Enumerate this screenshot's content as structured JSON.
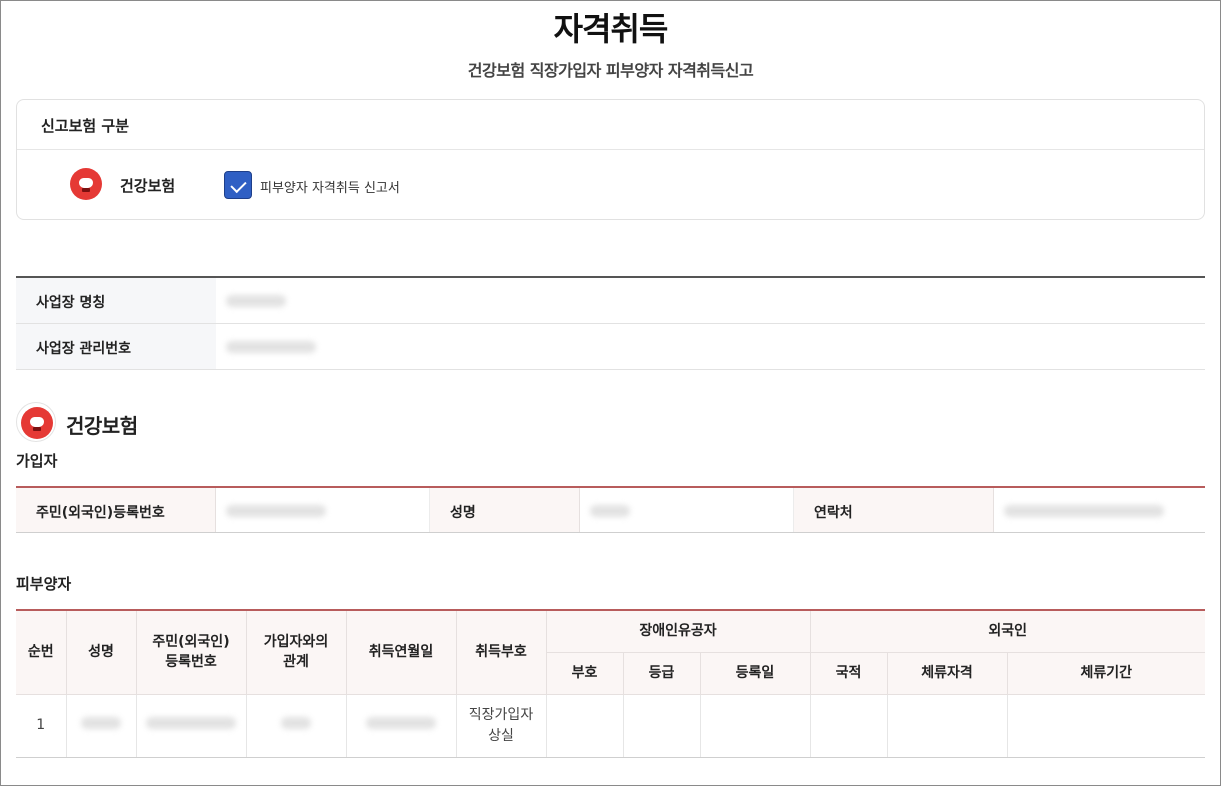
{
  "page": {
    "title": "자격취득",
    "subtitle": "건강보험 직장가입자 피부양자 자격취득신고"
  },
  "insurance_box": {
    "heading": "신고보험 구분",
    "insurance_name": "건강보험",
    "checkbox_label": "피부양자 자격취득 신고서",
    "checkbox_checked": true,
    "logo_icon": "nhis-heart-logo-icon"
  },
  "workplace": {
    "rows": [
      {
        "label": "사업장 명칭",
        "value": ""
      },
      {
        "label": "사업장 관리번호",
        "value": ""
      }
    ]
  },
  "section": {
    "name": "건강보험",
    "subscriber_title": "가입자",
    "dependent_title": "피부양자"
  },
  "subscriber": {
    "resident_no_label": "주민(외국인)등록번호",
    "name_label": "성명",
    "contact_label": "연락처"
  },
  "dependents": {
    "headers": {
      "seq": "순번",
      "name": "성명",
      "resident_no": "주민(외국인)\n등록번호",
      "relation": "가입자와의\n관계",
      "acquired_date": "취득연월일",
      "acquired_code": "취득부호",
      "disabled_group": "장애인유공자",
      "disabled_code": "부호",
      "disabled_grade": "등급",
      "disabled_reg_date": "등록일",
      "foreigner_group": "외국인",
      "nationality": "국적",
      "stay_status": "체류자격",
      "stay_period": "체류기간"
    },
    "rows": [
      {
        "seq": "1",
        "acquired_code": "직장가입자\n상실"
      }
    ]
  },
  "colors": {
    "accent_red": "#e53935",
    "checkbox_blue": "#2f5fc4",
    "table_rule": "#b85c5c"
  }
}
